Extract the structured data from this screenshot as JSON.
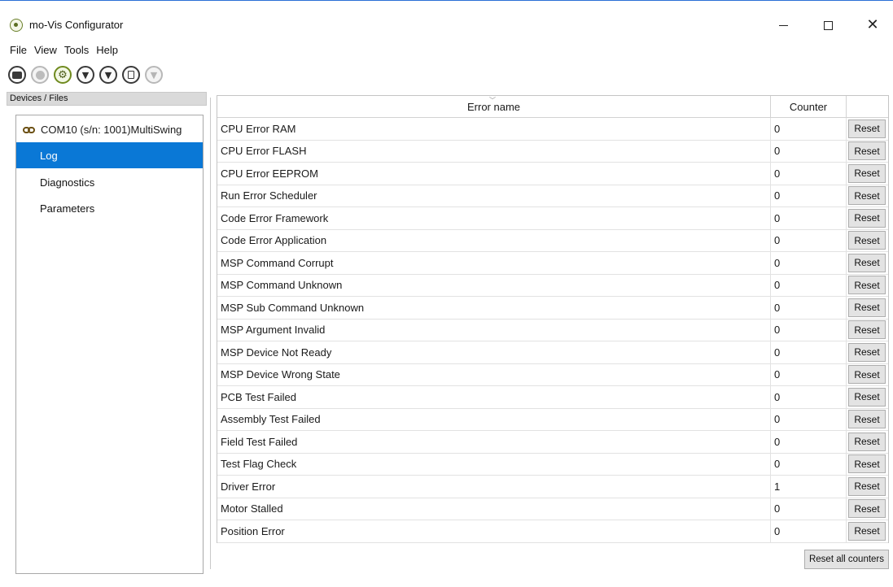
{
  "window": {
    "title": "mo-Vis Configurator",
    "minimize_glyph": "—",
    "maximize_glyph": "☐",
    "close_glyph": "✕"
  },
  "menu": [
    "File",
    "View",
    "Tools",
    "Help"
  ],
  "toolbar": {
    "buttons": [
      {
        "icon": "open-folder-icon",
        "state": "enabled"
      },
      {
        "icon": "device-settings-icon",
        "state": "disabled"
      },
      {
        "icon": "gear-icon",
        "state": "enabled"
      },
      {
        "icon": "download-to-device-icon",
        "state": "enabled"
      },
      {
        "icon": "download-from-device-icon",
        "state": "enabled"
      },
      {
        "icon": "report-document-icon",
        "state": "enabled"
      },
      {
        "icon": "arrow-down-icon",
        "state": "disabled"
      }
    ]
  },
  "devices": {
    "header": "Devices / Files",
    "device_label": "COM10 (s/n: 1001)MultiSwing",
    "items": [
      {
        "label": "Log",
        "selected": true
      },
      {
        "label": "Diagnostics",
        "selected": false
      },
      {
        "label": "Parameters",
        "selected": false
      }
    ]
  },
  "table": {
    "columns": {
      "name": "Error name",
      "counter": "Counter"
    },
    "reset_label": "Reset",
    "rows": [
      {
        "name": "CPU Error RAM",
        "counter": "0"
      },
      {
        "name": "CPU Error FLASH",
        "counter": "0"
      },
      {
        "name": "CPU Error EEPROM",
        "counter": "0"
      },
      {
        "name": "Run Error Scheduler",
        "counter": "0"
      },
      {
        "name": "Code Error Framework",
        "counter": "0"
      },
      {
        "name": "Code Error Application",
        "counter": "0"
      },
      {
        "name": "MSP Command Corrupt",
        "counter": "0"
      },
      {
        "name": "MSP Command Unknown",
        "counter": "0"
      },
      {
        "name": "MSP Sub Command Unknown",
        "counter": "0"
      },
      {
        "name": "MSP Argument Invalid",
        "counter": "0"
      },
      {
        "name": "MSP Device Not Ready",
        "counter": "0"
      },
      {
        "name": "MSP Device Wrong State",
        "counter": "0"
      },
      {
        "name": "PCB Test Failed",
        "counter": "0"
      },
      {
        "name": "Assembly Test Failed",
        "counter": "0"
      },
      {
        "name": "Field Test Failed",
        "counter": "0"
      },
      {
        "name": "Test Flag Check",
        "counter": "0"
      },
      {
        "name": "Driver Error",
        "counter": "1"
      },
      {
        "name": "Motor Stalled",
        "counter": "0"
      },
      {
        "name": "Position Error",
        "counter": "0"
      }
    ]
  },
  "reset_all_label": "Reset all counters",
  "colors": {
    "selection": "#0a78d6",
    "button_face": "#e3e3e3",
    "accent_green": "#6f8a1e"
  }
}
